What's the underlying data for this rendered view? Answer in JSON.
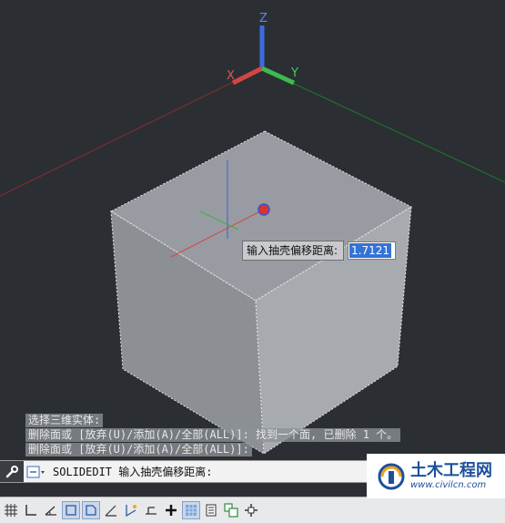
{
  "viewport": {
    "ucs_axes": {
      "x": "X",
      "y": "Y",
      "z": "Z"
    }
  },
  "dynamic_input": {
    "prompt": "输入抽壳偏移距离:",
    "value": "1.7121"
  },
  "command_history": [
    "选择三维实体:",
    "删除面或 [放弃(U)/添加(A)/全部(ALL)]: 找到一个面, 已删除 1 个。",
    "删除面或 [放弃(U)/添加(A)/全部(ALL)]:"
  ],
  "command_line": {
    "text": "SOLIDEDIT 输入抽壳偏移距离:"
  },
  "status_bar": {
    "buttons": [
      {
        "name": "grid-icon",
        "on": false
      },
      {
        "name": "ortho-icon",
        "on": false
      },
      {
        "name": "polar-icon",
        "on": false
      },
      {
        "name": "osnap-icon",
        "on": true
      },
      {
        "name": "3d-osnap-icon",
        "on": true
      },
      {
        "name": "otrack-icon",
        "on": false
      },
      {
        "name": "ducs-icon",
        "on": false
      },
      {
        "name": "dyn-icon",
        "on": false
      },
      {
        "name": "lineweight-icon",
        "on": false
      },
      {
        "name": "transparency-icon",
        "on": true
      },
      {
        "name": "quick-properties-icon",
        "on": false
      },
      {
        "name": "selection-cycling-icon",
        "on": false
      },
      {
        "name": "annotation-monitor-icon",
        "on": false
      }
    ]
  },
  "watermark": {
    "title": "土木工程网",
    "url": "www.civilcn.com"
  }
}
